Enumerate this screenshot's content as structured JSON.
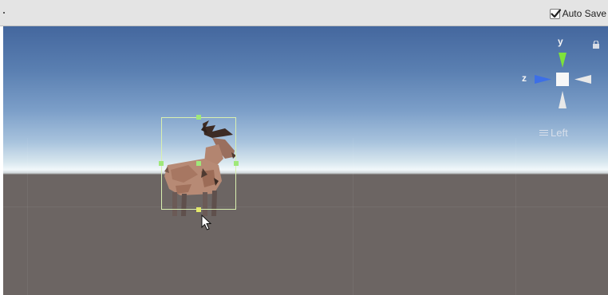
{
  "toolbar": {
    "auto_save": {
      "label": "Auto Save",
      "checked": true
    }
  },
  "scene_view": {
    "gizmo": {
      "axis_y": "y",
      "axis_z": "z",
      "view_label": "Left"
    },
    "colors": {
      "y_axis": "#7ee23a",
      "z_axis": "#3d6fe6",
      "x_axis_cone": "#e8e8e8",
      "selection_outline": "#d9f0b0",
      "handle": "#9fe87a"
    }
  }
}
